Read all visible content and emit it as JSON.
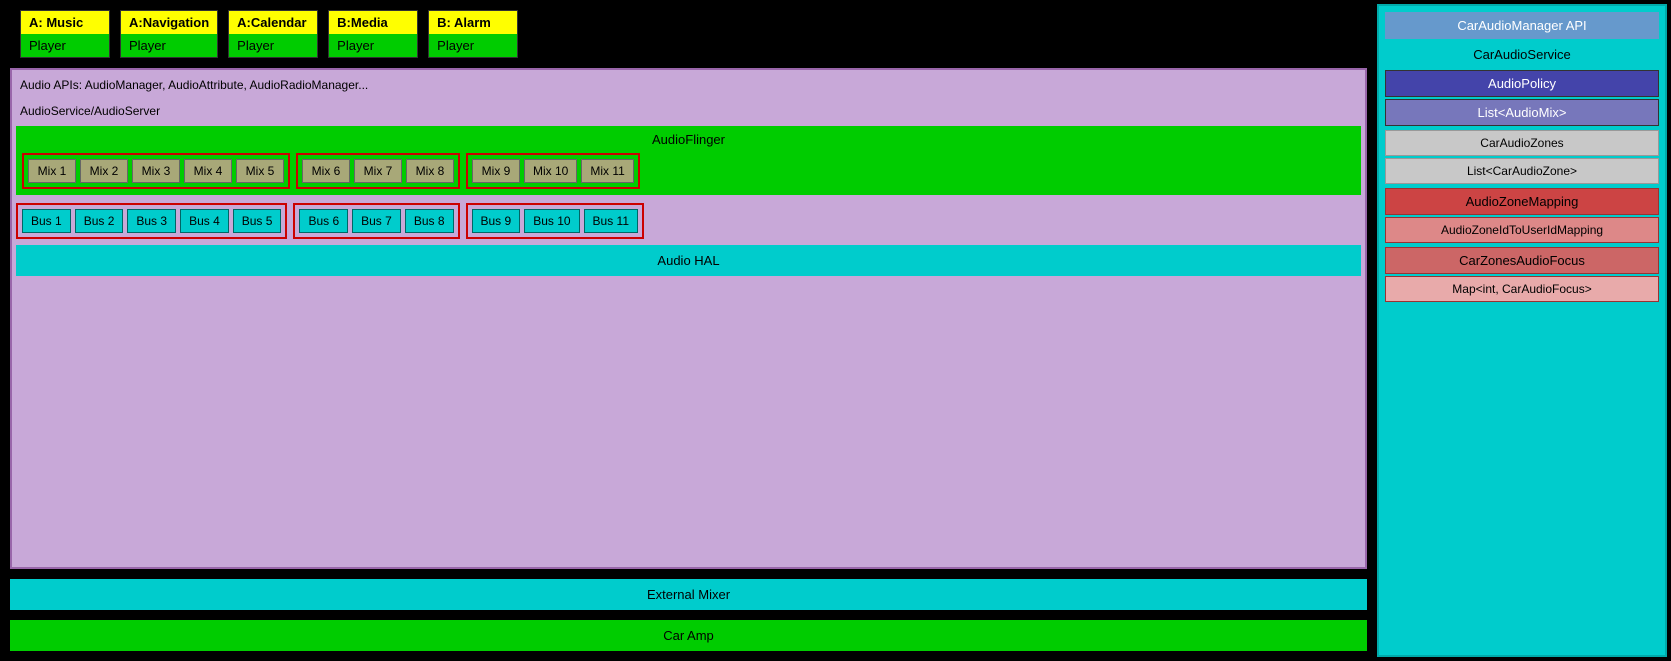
{
  "apps": [
    {
      "id": "a-music",
      "top": "A: Music",
      "bottom": "Player"
    },
    {
      "id": "a-navigation",
      "top": "A:Navigation",
      "bottom": "Player"
    },
    {
      "id": "a-calendar",
      "top": "A:Calendar",
      "bottom": "Player"
    },
    {
      "id": "b-media",
      "top": "B:Media",
      "bottom": "Player"
    },
    {
      "id": "b-alarm",
      "top": "B: Alarm",
      "bottom": "Player"
    }
  ],
  "audioApis": "Audio APIs: AudioManager, AudioAttribute, AudioRadioManager...",
  "audioServer": "AudioService/AudioServer",
  "audioFlinger": "AudioFlinger",
  "zones": [
    {
      "id": "zone1",
      "mixes": [
        "Mix 1",
        "Mix 2",
        "Mix 3",
        "Mix 4",
        "Mix 5"
      ],
      "buses": [
        "Bus 1",
        "Bus 2",
        "Bus 3",
        "Bus 4",
        "Bus 5"
      ]
    },
    {
      "id": "zone2",
      "mixes": [
        "Mix 6",
        "Mix 7",
        "Mix 8"
      ],
      "buses": [
        "Bus 6",
        "Bus 7",
        "Bus 8"
      ]
    },
    {
      "id": "zone3",
      "mixes": [
        "Mix 9",
        "Mix 10",
        "Mix 11"
      ],
      "buses": [
        "Bus 9",
        "Bus 10",
        "Bus 11"
      ]
    }
  ],
  "audioHal": "Audio HAL",
  "externalMixer": "External Mixer",
  "carAmp": "Car Amp",
  "rightPanel": {
    "api": "CarAudioManager API",
    "service": "CarAudioService",
    "audioPolicy": "AudioPolicy",
    "listAudioMix": "List<AudioMix>",
    "carAudioZones": "CarAudioZones",
    "listCarAudioZone": "List<CarAudioZone>",
    "audioZoneMapping": "AudioZoneMapping",
    "audioZoneIdToUserIdMapping": "AudioZoneIdToUserIdMapping",
    "carZonesAudioFocus": "CarZonesAudioFocus",
    "mapIntCarAudioFocus": "Map<int, CarAudioFocus>"
  }
}
